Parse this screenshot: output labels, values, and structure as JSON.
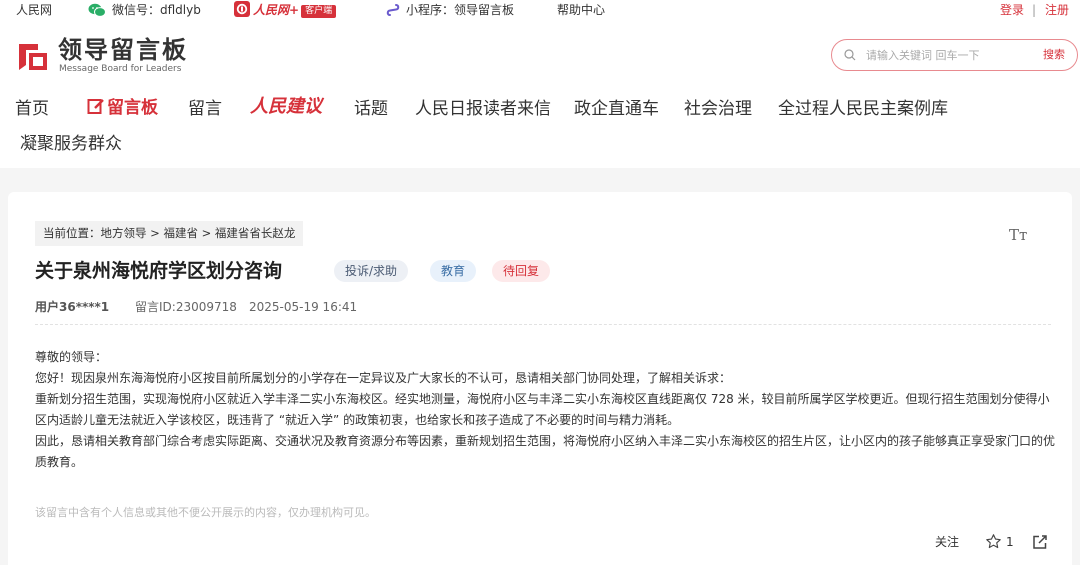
{
  "topbar": {
    "site": "人民网",
    "wechat_label": "微信号：dfldlyb",
    "client_logo_text": "人民网+",
    "client_badge": "客户端",
    "miniprogram_label": "小程序：领导留言板",
    "help": "帮助中心",
    "login": "登录",
    "separator": "|",
    "register": "注册"
  },
  "header": {
    "logo_title": "领导留言板",
    "logo_subtitle": "Message Board for Leaders",
    "search_placeholder": "请输入关键词 回车一下",
    "search_button": "搜索"
  },
  "nav": {
    "items": [
      {
        "label": "首页"
      },
      {
        "label": "留言板"
      },
      {
        "label": "留言"
      },
      {
        "label": "人民建议"
      },
      {
        "label": "话题"
      },
      {
        "label": "人民日报读者来信"
      },
      {
        "label": "政企直通车"
      },
      {
        "label": "社会治理"
      },
      {
        "label": "全过程人民民主案例库"
      },
      {
        "label": "凝聚服务群众"
      }
    ]
  },
  "breadcrumb": "当前位置：地方领导 > 福建省 > 福建省省长赵龙",
  "font_size_icon": "Tт",
  "message": {
    "title": "关于泉州海悦府学区划分咨询",
    "tags": {
      "type": "投诉/求助",
      "field": "教育",
      "status": "待回复"
    },
    "user": "用户36****1",
    "message_id": "留言ID:23009718",
    "time": "2025-05-19 16:41",
    "paragraphs": [
      "尊敬的领导：",
      "您好！现因泉州东海海悦府小区按目前所属划分的小学存在一定异议及广大家长的不认可，恳请相关部门协同处理，了解相关诉求：",
      "重新划分招生范围，实现海悦府小区就近入学丰泽二实小东海校区。经实地测量，海悦府小区与丰泽二实小东海校区直线距离仅 728 米，较目前所属学区学校更近。但现行招生范围划分使得小区内适龄儿童无法就近入学该校区，既违背了 “就近入学” 的政策初衷，也给家长和孩子造成了不必要的时间与精力消耗。",
      "因此，恳请相关教育部门综合考虑实际距离、交通状况及教育资源分布等因素，重新规划招生范围，将海悦府小区纳入丰泽二实小东海校区的招生片区，让小区内的孩子能够真正享受家门口的优质教育。"
    ],
    "privacy_note": "该留言中含有个人信息或其他不便公开展示的内容，仅办理机构可见。",
    "actions": {
      "follow": "关注",
      "star_count": "1"
    }
  },
  "colors": {
    "brand_red": "#d6313a",
    "wechat_green": "#2aae67",
    "miniprogram_purple": "#6a5acd"
  }
}
